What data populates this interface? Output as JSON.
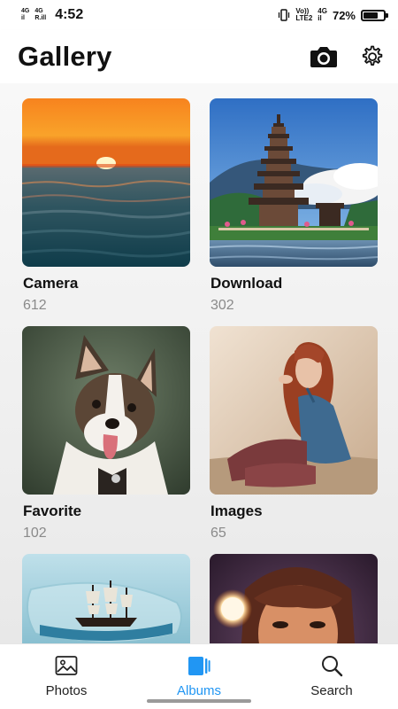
{
  "status_bar": {
    "net_left_1": [
      "4G",
      "il"
    ],
    "net_left_2": [
      "4G",
      "R.ill"
    ],
    "time": "4:52",
    "volte": [
      "Vo))",
      "LTE2"
    ],
    "net_right": [
      "4G",
      "il"
    ],
    "battery": "72%",
    "battery_level": 0.72
  },
  "header": {
    "title": "Gallery",
    "camera_icon": "camera-icon",
    "settings_icon": "gear-icon"
  },
  "albums": [
    {
      "name": "Camera",
      "count": "612"
    },
    {
      "name": "Download",
      "count": "302"
    },
    {
      "name": "Favorite",
      "count": "102"
    },
    {
      "name": "Images",
      "count": "65"
    },
    {
      "name": "",
      "count": ""
    },
    {
      "name": "",
      "count": ""
    }
  ],
  "bottom_nav": {
    "items": [
      {
        "label": "Photos",
        "icon": "image-icon"
      },
      {
        "label": "Albums",
        "icon": "albums-icon"
      },
      {
        "label": "Search",
        "icon": "search-icon"
      }
    ],
    "active": "Albums",
    "accent": "#2196f3"
  }
}
